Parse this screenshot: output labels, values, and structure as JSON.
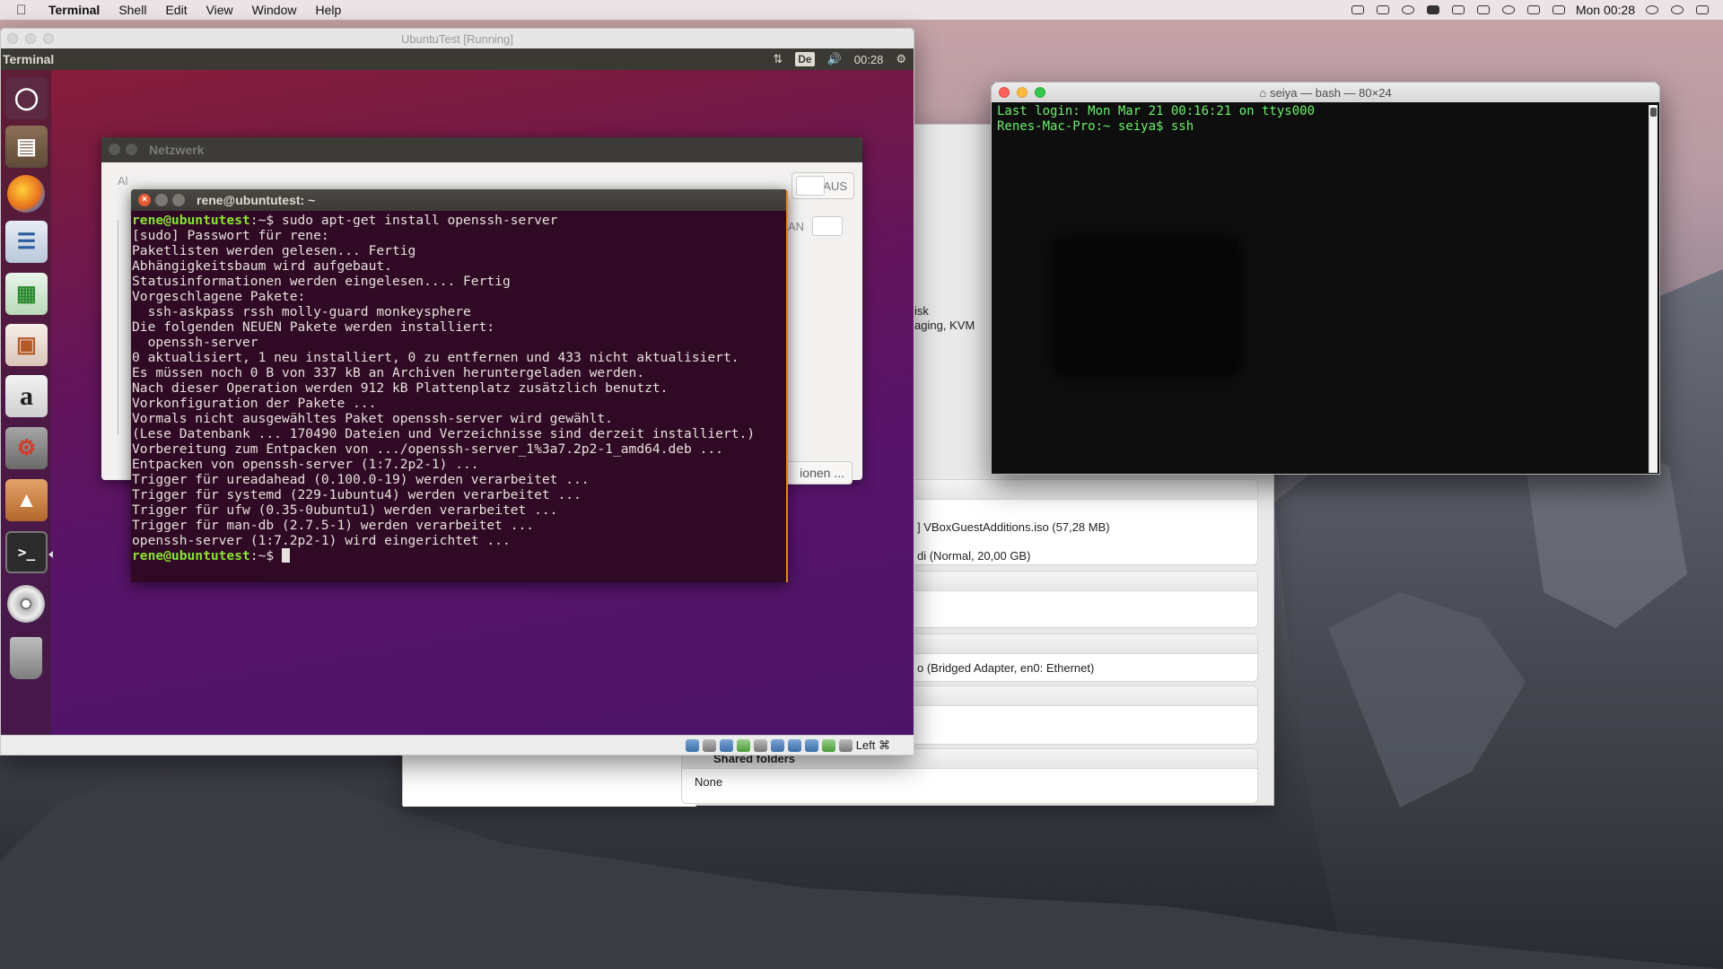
{
  "menubar": {
    "app": "Terminal",
    "items": [
      "Shell",
      "Edit",
      "View",
      "Window",
      "Help"
    ],
    "clock": "Mon 00:28"
  },
  "vbox": {
    "title": "UbuntuTest [Running]",
    "status_key": "Left ⌘"
  },
  "ubuntu": {
    "topbar_title": "Terminal",
    "keyboard": "De",
    "clock": "00:28"
  },
  "netzwerk": {
    "title": "Netzwerk",
    "left_fragment": "Al",
    "toggle_off": "AUS",
    "toggle_on": "AN",
    "options_button": "ionen ..."
  },
  "ubuntu_terminal": {
    "title": "rene@ubuntutest: ~",
    "prompt": "rene@ubuntutest",
    "prompt_suffix": ":~$ ",
    "command": "sudo apt-get install openssh-server",
    "output": [
      "[sudo] Passwort für rene:",
      "Paketlisten werden gelesen... Fertig",
      "Abhängigkeitsbaum wird aufgebaut.",
      "Statusinformationen werden eingelesen.... Fertig",
      "Vorgeschlagene Pakete:",
      "  ssh-askpass rssh molly-guard monkeysphere",
      "Die folgenden NEUEN Pakete werden installiert:",
      "  openssh-server",
      "0 aktualisiert, 1 neu installiert, 0 zu entfernen und 433 nicht aktualisiert.",
      "Es müssen noch 0 B von 337 kB an Archiven heruntergeladen werden.",
      "Nach dieser Operation werden 912 kB Plattenplatz zusätzlich benutzt.",
      "Vorkonfiguration der Pakete ...",
      "Vormals nicht ausgewähltes Paket openssh-server wird gewählt.",
      "(Lese Datenbank ... 170490 Dateien und Verzeichnisse sind derzeit installiert.)",
      "Vorbereitung zum Entpacken von .../openssh-server_1%3a7.2p2-1_amd64.deb ...",
      "Entpacken von openssh-server (1:7.2p2-1) ...",
      "Trigger für ureadahead (0.100.0-19) werden verarbeitet ...",
      "Trigger für systemd (229-1ubuntu4) werden verarbeitet ...",
      "Trigger für ufw (0.35-0ubuntu1) werden verarbeitet ...",
      "Trigger für man-db (2.7.5-1) werden verarbeitet ...",
      "openssh-server (1:7.2p2-1) wird eingerichtet ..."
    ]
  },
  "vbox_manager": {
    "frag_disk": "isk",
    "frag_kvm": "aging, KVM",
    "storage_iso": "] VBoxGuestAdditions.iso (57,28 MB)",
    "storage_vdi": "di (Normal, 20,00 GB)",
    "network": "o (Bridged Adapter, en0: Ethernet)",
    "shared_folders_header": "Shared folders",
    "shared_folders_value": "None"
  },
  "mac_terminal": {
    "title": "seiya — bash — 80×24",
    "lines": [
      "Last login: Mon Mar 21 00:16:21 on ttys000",
      "Renes-Mac-Pro:~ seiya$ ssh"
    ]
  }
}
